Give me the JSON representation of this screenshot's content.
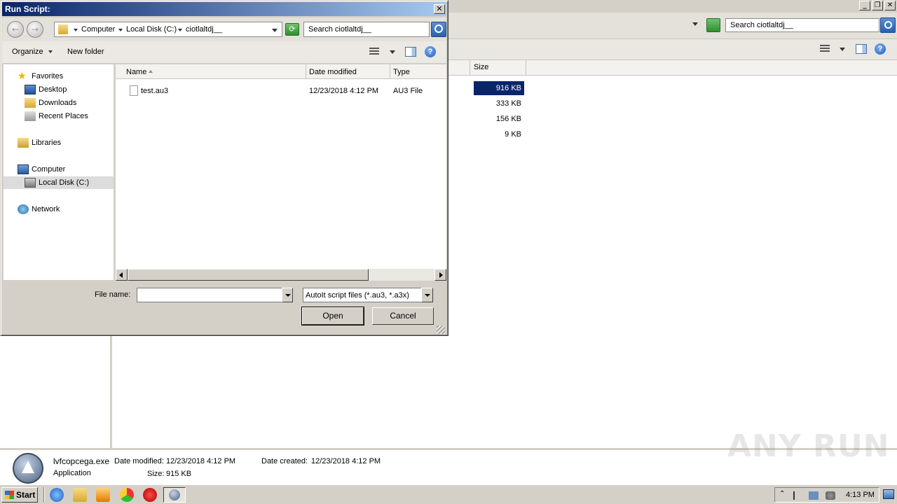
{
  "background_window": {
    "search_placeholder": "Search ciotlaltdj__",
    "column_size": "Size",
    "sizes": [
      "916 KB",
      "333 KB",
      "156 KB",
      "9 KB"
    ],
    "selected_size_index": 0
  },
  "status_bar": {
    "file_name": "lvfcopcega.exe",
    "file_type": "Application",
    "date_modified_label": "Date modified:",
    "date_modified_value": "12/23/2018 4:12 PM",
    "size_label": "Size:",
    "size_value": "915 KB",
    "date_created_label": "Date created:",
    "date_created_value": "12/23/2018 4:12 PM"
  },
  "dialog": {
    "title": "Run Script:",
    "close_glyph": "✕",
    "breadcrumb": [
      "Computer",
      "Local Disk (C:)",
      "ciotlaltdj__"
    ],
    "search_placeholder": "Search ciotlaltdj__",
    "toolbar": {
      "organize": "Organize",
      "new_folder": "New folder",
      "help_glyph": "?"
    },
    "nav": {
      "favorites": "Favorites",
      "desktop": "Desktop",
      "downloads": "Downloads",
      "recent_places": "Recent Places",
      "libraries": "Libraries",
      "computer": "Computer",
      "local_disk": "Local Disk (C:)",
      "network": "Network"
    },
    "columns": {
      "name": "Name",
      "date_modified": "Date modified",
      "type": "Type"
    },
    "files": [
      {
        "name": "test.au3",
        "date_modified": "12/23/2018 4:12 PM",
        "type": "AU3 File"
      }
    ],
    "file_name_label": "File name:",
    "file_name_value": "",
    "file_type_value": "AutoIt script files (*.au3, *.a3x)",
    "open_button": "Open",
    "cancel_button": "Cancel"
  },
  "taskbar": {
    "start_label": "Start",
    "clock": "4:13 PM"
  },
  "watermark": "ANY RUN",
  "colors": {
    "title_gradient_start": "#0a246a",
    "title_gradient_end": "#a6caf0",
    "selection": "#0a246a",
    "chrome": "#d4d0c8"
  }
}
